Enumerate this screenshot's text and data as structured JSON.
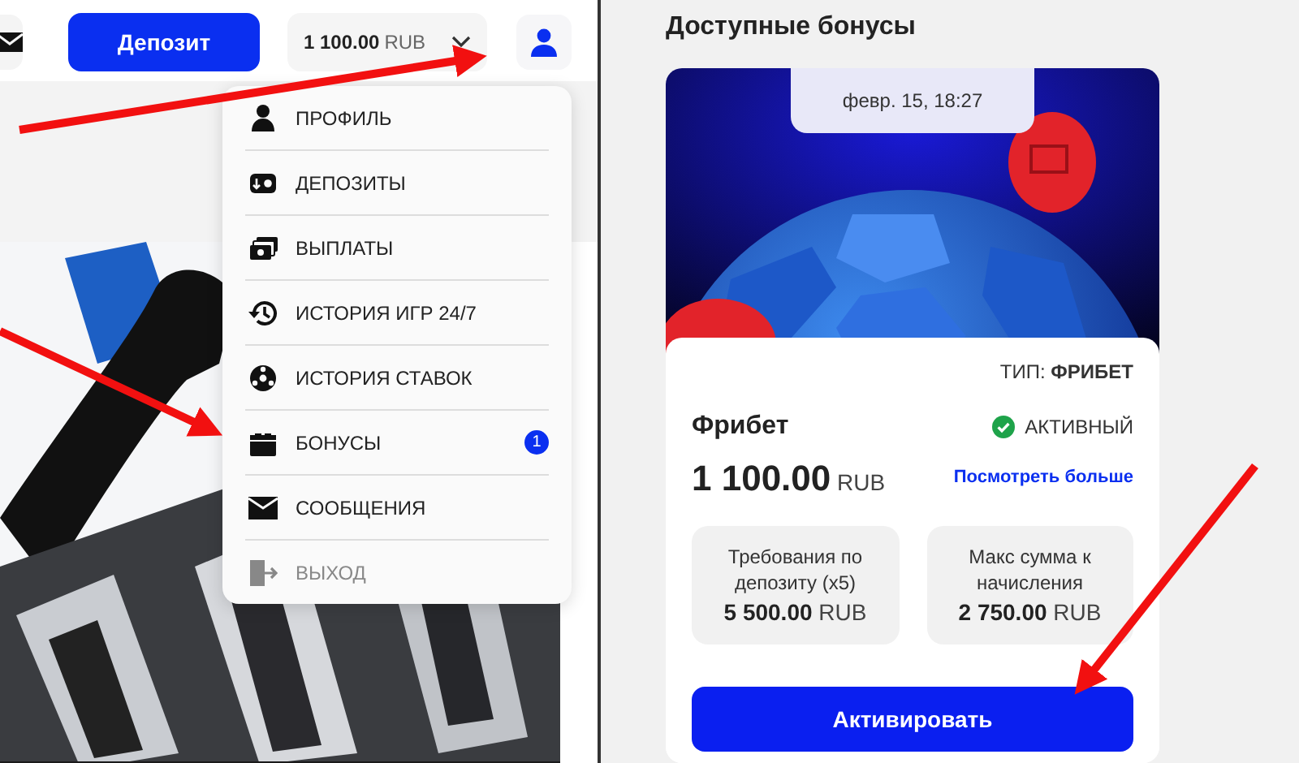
{
  "left_screen": {
    "header": {
      "deposit_button": "Депозит",
      "balance": {
        "amount": "1 100.00",
        "currency": "RUB"
      }
    },
    "user_menu": {
      "items": [
        {
          "kind": "profile",
          "label": "ПРОФИЛЬ"
        },
        {
          "kind": "deposits",
          "label": "ДЕПОЗИТЫ"
        },
        {
          "kind": "payouts",
          "label": "ВЫПЛАТЫ"
        },
        {
          "kind": "history",
          "label": "ИСТОРИЯ ИГР 24/7"
        },
        {
          "kind": "bets",
          "label": "ИСТОРИЯ СТАВОК"
        },
        {
          "kind": "bonuses",
          "label": "БОНУСЫ",
          "badge": "1"
        },
        {
          "kind": "messages",
          "label": "СООБЩЕНИЯ"
        },
        {
          "kind": "logout",
          "label": "ВЫХОД",
          "disabled": true
        }
      ]
    }
  },
  "right_screen": {
    "title": "Доступные бонусы",
    "bonus_card": {
      "date": "февр. 15, 18:27",
      "type_label": "ТИП:",
      "type_value": "ФРИБЕТ",
      "name": "Фрибет",
      "status": {
        "label": "АКТИВНЫЙ",
        "active": true
      },
      "amount": "1 100.00",
      "currency": "RUB",
      "more_link": "Посмотреть больше",
      "stats": [
        {
          "label": "Требования по депозиту (x5)",
          "amount": "5 500.00",
          "currency": "RUB"
        },
        {
          "label": "Макс сумма к начисления",
          "amount": "2 750.00",
          "currency": "RUB"
        }
      ],
      "activate_button": "Активировать"
    }
  }
}
